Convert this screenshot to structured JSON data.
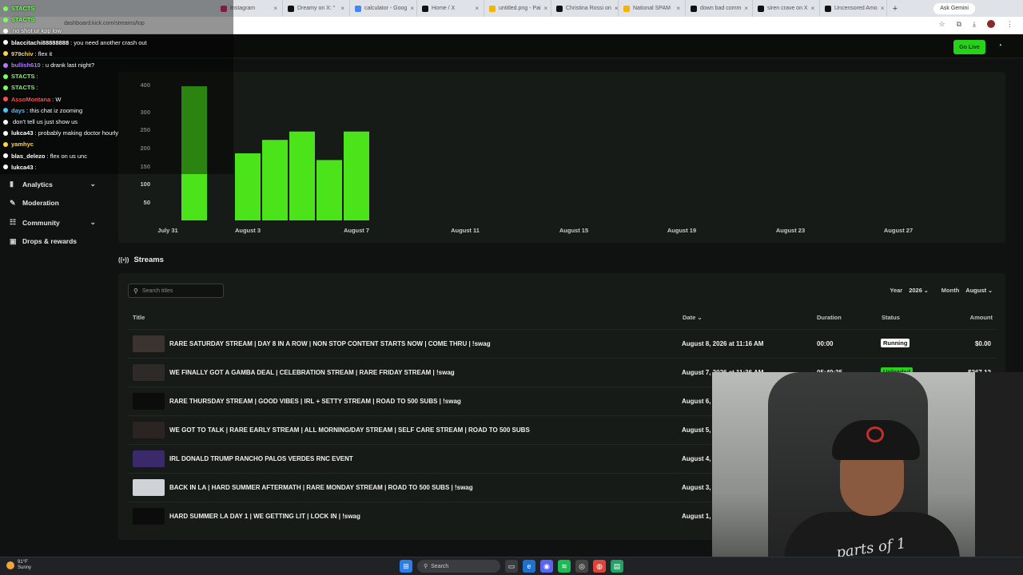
{
  "browser": {
    "tabs": [
      {
        "label": "Instagram",
        "color": "#e1306c"
      },
      {
        "label": "Dreamy on X: \"",
        "color": "#111111"
      },
      {
        "label": "calculator - Goog",
        "color": "#4285f4"
      },
      {
        "label": "Home / X",
        "color": "#111111"
      },
      {
        "label": "untitled.png - Pai",
        "color": "#f4b400"
      },
      {
        "label": "Christina Rossi on",
        "color": "#111111"
      },
      {
        "label": "National SPAM",
        "color": "#f4b400"
      },
      {
        "label": "down bad comm",
        "color": "#111111"
      },
      {
        "label": "siren crave on X",
        "color": "#111111"
      },
      {
        "label": "Uncensored Amo",
        "color": "#111111"
      }
    ],
    "ask_label": "Ask Gemini",
    "url": "dashboard.kick.com/streams/top"
  },
  "app": {
    "go_live_label": "Go Live",
    "accent": "#27d318"
  },
  "sidebar": {
    "items": [
      {
        "label": "Analytics",
        "icon": "analytics-icon",
        "has_chevron": true
      },
      {
        "label": "Moderation",
        "icon": "wrench-icon",
        "has_chevron": false
      },
      {
        "label": "Community",
        "icon": "community-icon",
        "has_chevron": true
      },
      {
        "label": "Drops & rewards",
        "icon": "gift-icon",
        "has_chevron": false
      }
    ]
  },
  "chart_data": {
    "type": "bar",
    "y_ticks": [
      "400",
      "300",
      "250",
      "200",
      "150",
      "100",
      "50"
    ],
    "x_ticks": [
      "July 31",
      "August 3",
      "August 7",
      "August 11",
      "August 15",
      "August 19",
      "August 23",
      "August 27"
    ],
    "bars": [
      {
        "x": "July 31",
        "value": 400
      },
      {
        "x": "August 3",
        "value": 200
      },
      {
        "x": "August 4",
        "value": 240
      },
      {
        "x": "August 5",
        "value": 265
      },
      {
        "x": "August 6",
        "value": 180
      },
      {
        "x": "August 7",
        "value": 265
      }
    ],
    "bar_color": "#4be31a"
  },
  "streams": {
    "heading": "Streams",
    "search_placeholder": "Search titles",
    "year_label": "Year",
    "year_value": "2026",
    "month_label": "Month",
    "month_value": "August",
    "columns": {
      "title": "Title",
      "date": "Date",
      "duration": "Duration",
      "status": "Status",
      "amount": "Amount"
    },
    "rows": [
      {
        "title": "RARE SATURDAY STREAM | DAY 8 IN A ROW | NON STOP CONTENT STARTS NOW | COME THRU | !swag",
        "date": "August 8, 2026 at 11:16 AM",
        "duration": "00:00",
        "status": "Running",
        "amount": "$0.00"
      },
      {
        "title": "WE FINALLY GOT A GAMBA DEAL | CELEBRATION STREAM | RARE FRIDAY STREAM | !swag",
        "date": "August 7, 2026 at 11:36 AM",
        "duration": "05:49:35",
        "status": "Uploaded",
        "amount": "$267.12"
      },
      {
        "title": "RARE THURSDAY STREAM | GOOD VIBES | IRL + SETTY STREAM | ROAD TO 500 SUBS | !swag",
        "date": "August 6,",
        "duration": "",
        "status": "",
        "amount": ""
      },
      {
        "title": "WE GOT TO TALK | RARE EARLY STREAM | ALL MORNING/DAY STREAM | SELF CARE STREAM | ROAD TO 500 SUBS",
        "date": "August 5,",
        "duration": "",
        "status": "",
        "amount": ""
      },
      {
        "title": "IRL DONALD TRUMP RANCHO PALOS VERDES RNC EVENT",
        "date": "August 4,",
        "duration": "",
        "status": "",
        "amount": ""
      },
      {
        "title": "BACK IN LA | HARD SUMMER AFTERMATH | RARE MONDAY STREAM | ROAD TO 500 SUBS | !swag",
        "date": "August 3,",
        "duration": "",
        "status": "",
        "amount": ""
      },
      {
        "title": "HARD SUMMER LA DAY 1 | WE GETTING LIT | LOCK IN | !swag",
        "date": "August 1,",
        "duration": "",
        "status": "",
        "amount": ""
      }
    ]
  },
  "chat": {
    "messages": [
      {
        "user": "STACTS",
        "text": "",
        "color": "#7cff5a"
      },
      {
        "user": "STACTS",
        "text": "",
        "color": "#7cff5a"
      },
      {
        "user": "",
        "text": "no shot ur kpp low",
        "color": "#ffffff"
      },
      {
        "user": "blaccitachi88888888",
        "text": ": you need another crash out",
        "color": "#ffffff"
      },
      {
        "user": "979chiv",
        "text": ": flex it",
        "color": "#ffd34f"
      },
      {
        "user": "bullish610",
        "text": ": u drank last night?",
        "color": "#b27cff"
      },
      {
        "user": "STACTS",
        "text": ":",
        "color": "#7cff5a"
      },
      {
        "user": "STACTS",
        "text": ":",
        "color": "#7cff5a"
      },
      {
        "user": "AssoMontana",
        "text": ": W",
        "color": "#ff4f4f"
      },
      {
        "user": "days",
        "text": ": this chat iz zooming",
        "color": "#4fc3ff"
      },
      {
        "user": "",
        "text": "don't tell us just show us",
        "color": "#ffffff"
      },
      {
        "user": "lukca43",
        "text": ": probably making doctor hourly",
        "color": "#ffffff"
      },
      {
        "user": "yamhyc",
        "text": "",
        "color": "#ffd34f"
      },
      {
        "user": "blas_delezo",
        "text": ": flex on us unc",
        "color": "#ffffff"
      },
      {
        "user": "lukca43",
        "text": ":",
        "color": "#ffffff"
      }
    ]
  },
  "cam": {
    "shirt_text": "parts of 1"
  },
  "taskbar": {
    "temp": "91°F",
    "condition": "Sunny",
    "search_label": "Search"
  }
}
